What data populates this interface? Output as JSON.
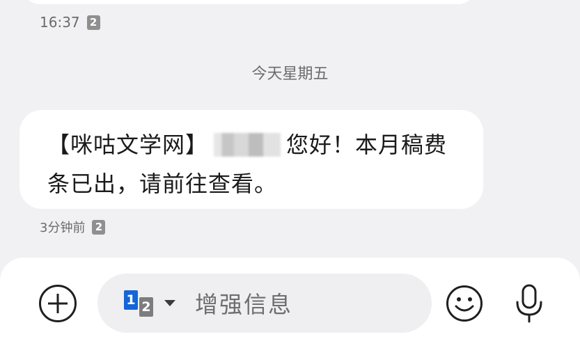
{
  "previous_message": {
    "time": "16:37",
    "sim": "2"
  },
  "date_divider": "今天星期五",
  "message": {
    "text_prefix": "【咪咕文学网】",
    "text_suffix": "您好！本月稿费条已出，请前往查看。",
    "time": "3分钟前",
    "sim": "2"
  },
  "compose": {
    "sim_primary": "1",
    "sim_secondary": "2",
    "placeholder": "增强信息",
    "icons": [
      "add-icon",
      "sim-switch-icon",
      "emoji-icon",
      "microphone-icon"
    ]
  }
}
